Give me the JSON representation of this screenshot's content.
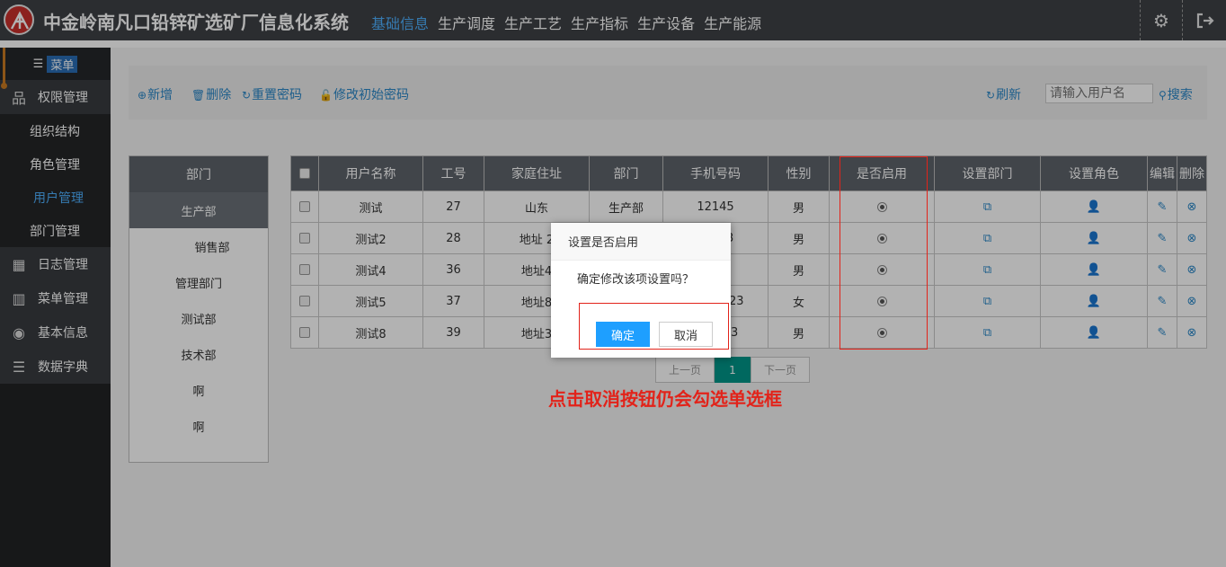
{
  "header": {
    "title": "中金岭南凡口铅锌矿选矿厂信息化系统",
    "nav": [
      "基础信息",
      "生产调度",
      "生产工艺",
      "生产指标",
      "生产设备",
      "生产能源"
    ],
    "active_nav": "基础信息",
    "icons": [
      "gear-icon",
      "logout-icon"
    ]
  },
  "sidebar": {
    "menu_label": "菜单",
    "groups": [
      {
        "label": "权限管理",
        "icon": "sitemap-icon"
      },
      {
        "label": "日志管理",
        "icon": "calendar-icon"
      },
      {
        "label": "菜单管理",
        "icon": "columns-icon"
      },
      {
        "label": "基本信息",
        "icon": "user-location-icon"
      },
      {
        "label": "数据字典",
        "icon": "list-icon"
      }
    ],
    "sub_items": [
      "组织结构",
      "角色管理",
      "用户管理",
      "部门管理"
    ],
    "active_sub": "用户管理"
  },
  "toolbar": {
    "add": "新增",
    "delete": "删除",
    "reset_pwd": "重置密码",
    "modify_pwd": "修改初始密码",
    "refresh": "刷新",
    "search_placeholder": "请输入用户名",
    "search": "搜索"
  },
  "departments": {
    "header": "部门",
    "items": [
      "生产部",
      "销售部",
      "管理部门",
      "测试部",
      "技术部",
      "啊",
      "啊"
    ],
    "active": "生产部"
  },
  "table": {
    "columns": [
      "用户名称",
      "工号",
      "家庭住址",
      "部门",
      "手机号码",
      "性别",
      "是否启用",
      "设置部门",
      "设置角色",
      "编辑",
      "删除"
    ],
    "rows": [
      {
        "name": "测试",
        "no": "27",
        "addr": "山东",
        "dept": "生产部",
        "phone": "12145",
        "sex": "男"
      },
      {
        "name": "测试2",
        "no": "28",
        "addr": "地址 2",
        "dept": "",
        "phone": "3",
        "sex": "男"
      },
      {
        "name": "测试4",
        "no": "36",
        "addr": "地址4",
        "dept": "",
        "phone": "",
        "sex": "男"
      },
      {
        "name": "测试5",
        "no": "37",
        "addr": "地址8",
        "dept": "",
        "phone": "23",
        "sex": "女"
      },
      {
        "name": "测试8",
        "no": "39",
        "addr": "地址3",
        "dept": "",
        "phone": "3",
        "sex": "男"
      }
    ]
  },
  "pager": {
    "prev": "上一页",
    "current": "1",
    "next": "下一页"
  },
  "dialog": {
    "title": "设置是否启用",
    "message": "确定修改该项设置吗？",
    "ok": "确定",
    "cancel": "取消"
  },
  "annotation": "点击取消按钮仍会勾选单选框",
  "colors": {
    "accent": "#1e9fff",
    "link": "#2a87c8",
    "annotation": "#e2231a",
    "pager_active": "#009688"
  }
}
